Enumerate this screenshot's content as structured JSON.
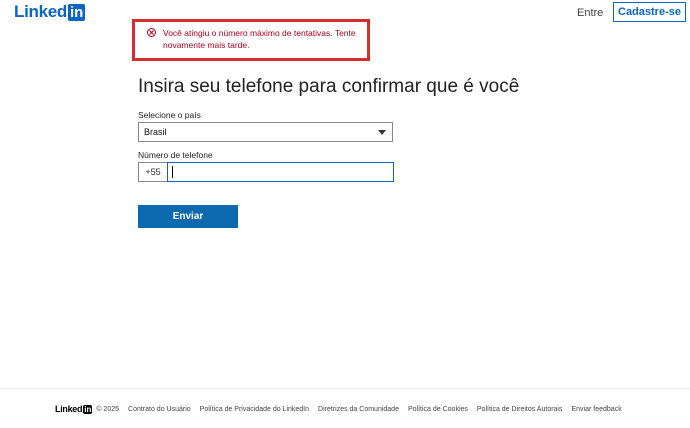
{
  "header": {
    "logo_text": "Linked",
    "logo_box": "in",
    "signin_label": "Entre",
    "signup_label": "Cadastre-se"
  },
  "error": {
    "icon": "error-circle-x-icon",
    "message": "Você atingiu o número máximo de tentativas. Tente novamente mais tarde."
  },
  "form": {
    "title": "Insira seu telefone para confirmar que é você",
    "country_label": "Selecione o país",
    "country_value": "Brasil",
    "phone_label": "Número de telefone",
    "phone_prefix": "+55",
    "phone_value": "",
    "submit_label": "Enviar"
  },
  "footer": {
    "logo_text": "Linked",
    "logo_box": "in",
    "copyright": "© 2025",
    "links": [
      "Contrato do Usuário",
      "Política de Privacidade do LinkedIn",
      "Diretrizes da Comunidade",
      "Política de Cookies",
      "Política de Direitos Autorais",
      "Enviar feedback"
    ]
  },
  "colors": {
    "brand": "#0a66c2",
    "error": "#b00020",
    "button": "#0b6aad"
  }
}
